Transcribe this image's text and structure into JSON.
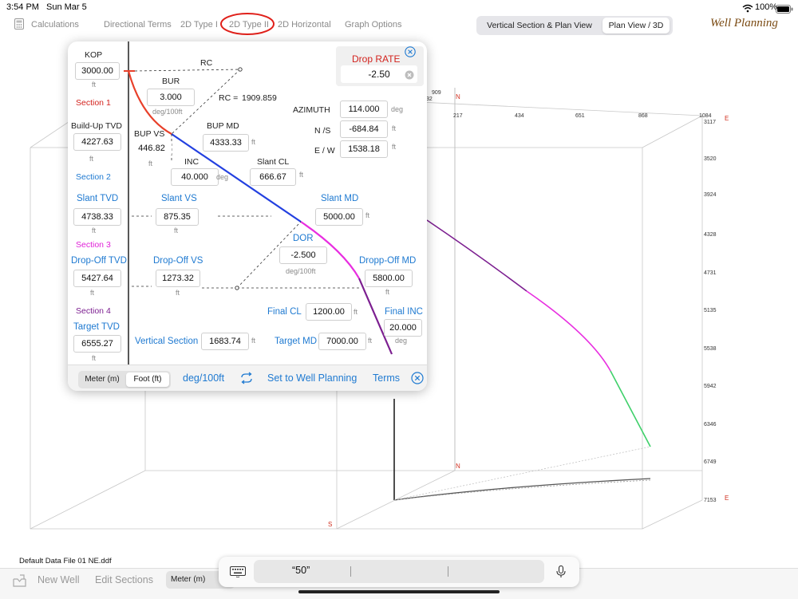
{
  "status": {
    "time": "3:54 PM",
    "date": "Sun Mar 5",
    "battery": "100%"
  },
  "nav": {
    "calculations": "Calculations",
    "directional_terms": "Directional Terms",
    "type1": "2D Type I",
    "type2": "2D Type II",
    "horizontal": "2D Horizontal",
    "graph_options": "Graph Options"
  },
  "view_toggle": {
    "left": "Vertical Section & Plan View",
    "right": "Plan View / 3D"
  },
  "brand": "Well Planning",
  "plot": {
    "top_ticks": [
      "217",
      "434",
      "651",
      "868",
      "1084"
    ],
    "partial_ticks": [
      "909",
      "32"
    ],
    "right_ticks": [
      "3117",
      "3520",
      "3924",
      "4328",
      "4731",
      "5135",
      "5538",
      "5942",
      "6346",
      "6749",
      "7153"
    ],
    "axis_n": "N",
    "axis_e": "E",
    "axis_s": "S"
  },
  "panel": {
    "kop": {
      "label": "KOP",
      "value": "3000.00",
      "unit": "ft"
    },
    "section1": "Section 1",
    "rc": {
      "label": "RC",
      "eq_label": "RC =",
      "value": "1909.859"
    },
    "bur": {
      "label": "BUR",
      "value": "3.000",
      "unit": "deg/100ft"
    },
    "drop_rate": {
      "label": "Drop RATE",
      "value": "-2.50"
    },
    "azimuth": {
      "label": "AZIMUTH",
      "value": "114.000",
      "unit": "deg"
    },
    "ns": {
      "label": "N /S",
      "value": "-684.84",
      "unit": "ft"
    },
    "ew": {
      "label": "E / W",
      "value": "1538.18",
      "unit": "ft"
    },
    "buildup_tvd": {
      "label": "Build-Up TVD",
      "value": "4227.63",
      "unit": "ft"
    },
    "bup_vs": {
      "label": "BUP VS",
      "value": "446.82",
      "unit": "ft"
    },
    "bup_md": {
      "label": "BUP MD",
      "value": "4333.33",
      "unit": "ft"
    },
    "section2": "Section 2",
    "inc": {
      "label": "INC",
      "value": "40.000",
      "unit": "deg"
    },
    "slant_cl": {
      "label": "Slant CL",
      "value": "666.67",
      "unit": "ft"
    },
    "slant_tvd": {
      "label": "Slant TVD",
      "value": "4738.33",
      "unit": "ft"
    },
    "slant_vs": {
      "label": "Slant VS",
      "value": "875.35",
      "unit": "ft"
    },
    "slant_md": {
      "label": "Slant MD",
      "value": "5000.00",
      "unit": "ft"
    },
    "section3": "Section 3",
    "dor": {
      "label": "DOR",
      "value": "-2.500",
      "unit": "deg/100ft"
    },
    "dropoff_tvd": {
      "label": "Drop-Off TVD",
      "value": "5427.64",
      "unit": "ft"
    },
    "dropoff_vs": {
      "label": "Drop-Off VS",
      "value": "1273.32",
      "unit": "ft"
    },
    "dropoff_md": {
      "label": "Dropp-Off MD",
      "value": "5800.00",
      "unit": "ft"
    },
    "section4": "Section 4",
    "final_cl": {
      "label": "Final CL",
      "value": "1200.00",
      "unit": "ft"
    },
    "final_inc": {
      "label": "Final INC",
      "value": "20.000",
      "unit": "deg"
    },
    "target_tvd": {
      "label": "Target TVD",
      "value": "6555.27",
      "unit": "ft"
    },
    "vertical_section": {
      "label": "Vertical Section",
      "value": "1683.74",
      "unit": "ft"
    },
    "target_md": {
      "label": "Target MD",
      "value": "7000.00",
      "unit": "ft"
    }
  },
  "footer": {
    "meter": "Meter (m)",
    "foot": "Foot (ft)",
    "units": "deg/100ft",
    "set_to": "Set to Well Planning",
    "terms": "Terms"
  },
  "file_name": "Default Data File 01 NE.ddf",
  "bottom": {
    "new_well": "New Well",
    "edit_sections": "Edit Sections",
    "meter": "Meter (m)"
  },
  "keyboard": {
    "suggestion": "“50”"
  },
  "colors": {
    "section1": "#e8402a",
    "section2": "#2340e0",
    "section3": "#e82ee0",
    "section4": "#7c1f90",
    "tail": "#3fd06a"
  }
}
